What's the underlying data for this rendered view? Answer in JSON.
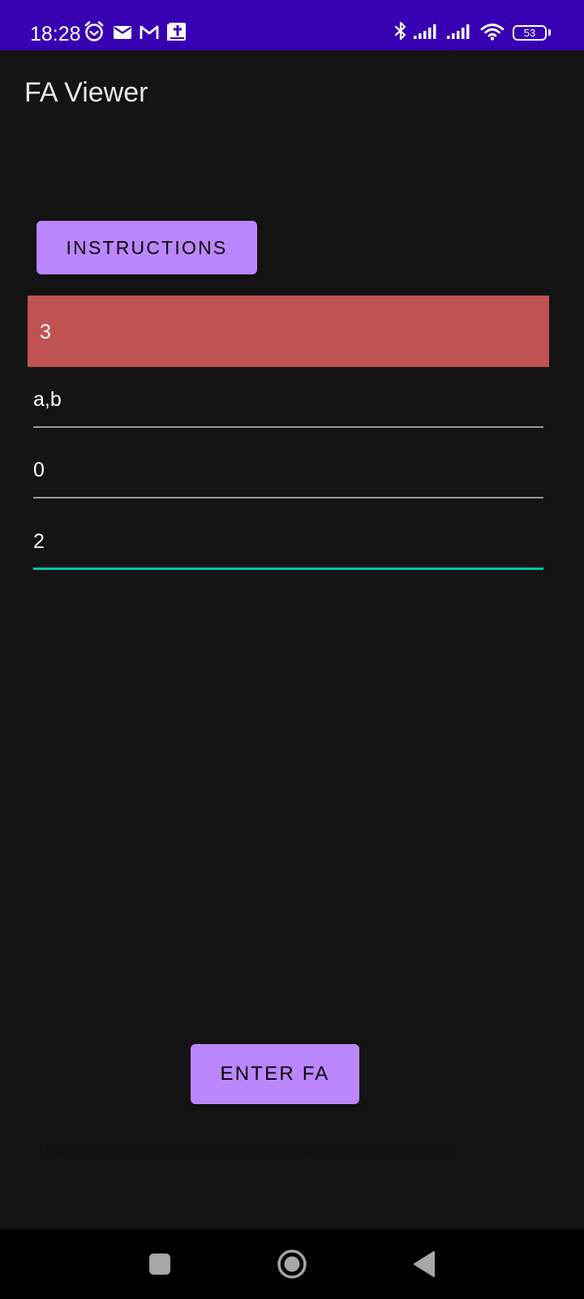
{
  "status_bar": {
    "time": "18:28",
    "battery": "53",
    "icons": [
      "alarm-icon",
      "mail-icon",
      "gmail-icon",
      "bible-app-icon",
      "bluetooth-icon",
      "signal-icon",
      "signal-icon",
      "wifi-icon",
      "battery-icon"
    ]
  },
  "app": {
    "title": "FA Viewer"
  },
  "buttons": {
    "instructions": "INSTRUCTIONS",
    "enter": "ENTER FA"
  },
  "fields": {
    "states": "3",
    "alphabet": "a,b",
    "start_state": "0",
    "final_states": "2"
  },
  "footer": {
    "note": "Display issues may occur if your phone is in dark mode or background"
  },
  "colors": {
    "status_bar": "#3700b3",
    "background": "#141414",
    "button": "#bb86fc",
    "highlight_field": "#c05252",
    "focus_underline": "#03c4b4"
  },
  "navigation": {
    "icons": [
      "recents-icon",
      "home-icon",
      "back-icon"
    ]
  }
}
